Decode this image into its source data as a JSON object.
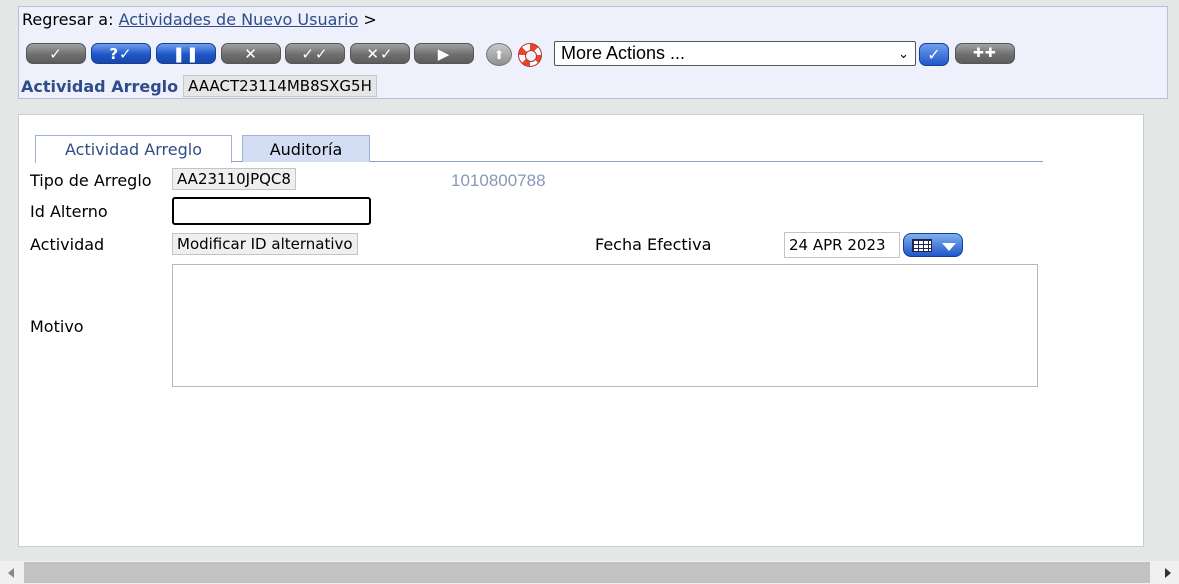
{
  "header": {
    "back_prefix": "Regresar a:",
    "back_link": "Actividades de Nuevo Usuario",
    "back_suffix": ">",
    "more_actions": {
      "selected": "More Actions ..."
    },
    "record_label": "Actividad Arreglo",
    "record_id": "AAACT23114MB8SXG5H"
  },
  "toolbar": {
    "buttons": [
      {
        "icon": "check-icon",
        "glyph": "✓"
      },
      {
        "icon": "question-check-icon",
        "glyph": "?✓"
      },
      {
        "icon": "pause-icon",
        "glyph": "❚❚"
      },
      {
        "icon": "cross-icon",
        "glyph": "✕"
      },
      {
        "icon": "double-check-icon",
        "glyph": "✓✓"
      },
      {
        "icon": "cross-check-icon",
        "glyph": "✕✓"
      },
      {
        "icon": "play-icon",
        "glyph": "▶"
      }
    ],
    "confirm_glyph": "✓",
    "add_glyph": "✚✚",
    "up_glyph": "⬆"
  },
  "tabs": [
    {
      "label": "Actividad Arreglo",
      "active": true
    },
    {
      "label": "Auditoría",
      "active": false
    }
  ],
  "form": {
    "tipo_arreglo_label": "Tipo de Arreglo",
    "tipo_arreglo_value": "AA23110JPQC8",
    "tipo_arreglo_number": "1010800788",
    "id_alterno_label": "Id Alterno",
    "id_alterno_value": "",
    "actividad_label": "Actividad",
    "actividad_value": "Modificar ID alternativo",
    "fecha_label": "Fecha Efectiva",
    "fecha_value": "24 APR 2023",
    "motivo_label": "Motivo",
    "motivo_value": ""
  },
  "colors": {
    "link": "#2f4d86",
    "header_bg": "#eef0fb",
    "tab_inactive_bg": "#d3ddf3",
    "blue_button": "#1f56c8"
  }
}
